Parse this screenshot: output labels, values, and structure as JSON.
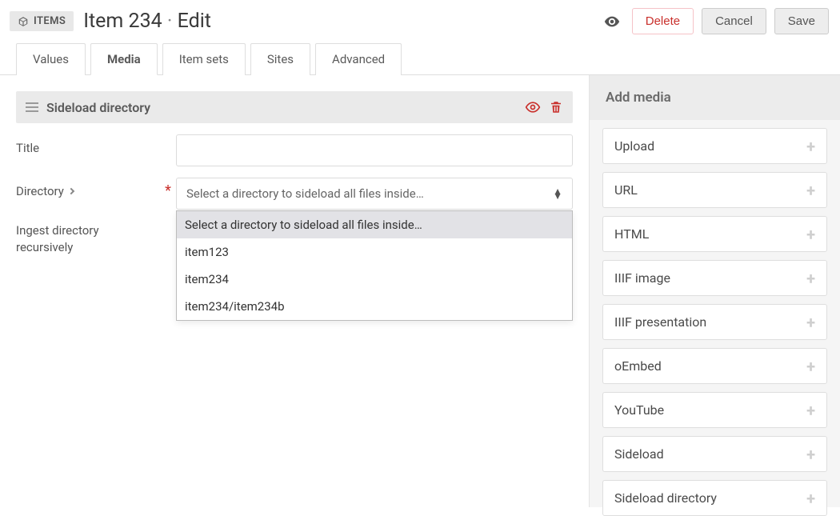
{
  "header": {
    "chip": "ITEMS",
    "title_item": "Item 234",
    "title_mode": "Edit",
    "delete": "Delete",
    "cancel": "Cancel",
    "save": "Save"
  },
  "tabs": {
    "values": "Values",
    "media": "Media",
    "item_sets": "Item sets",
    "sites": "Sites",
    "advanced": "Advanced"
  },
  "section": {
    "title": "Sideload directory"
  },
  "form": {
    "title_label": "Title",
    "title_value": "",
    "directory_label": "Directory",
    "directory_placeholder": "Select a directory to sideload all files inside…",
    "directory_options": {
      "placeholder": "Select a directory to sideload all files inside…",
      "o1": "item123",
      "o2": "item234",
      "o3": "item234/item234b"
    },
    "recursive_label_l1": "Ingest directory",
    "recursive_label_l2": "recursively"
  },
  "sidebar": {
    "title": "Add media",
    "items": {
      "upload": "Upload",
      "url": "URL",
      "html": "HTML",
      "iiif_image": "IIIF image",
      "iiif_presentation": "IIIF presentation",
      "oembed": "oEmbed",
      "youtube": "YouTube",
      "sideload": "Sideload",
      "sideload_directory": "Sideload directory"
    }
  }
}
